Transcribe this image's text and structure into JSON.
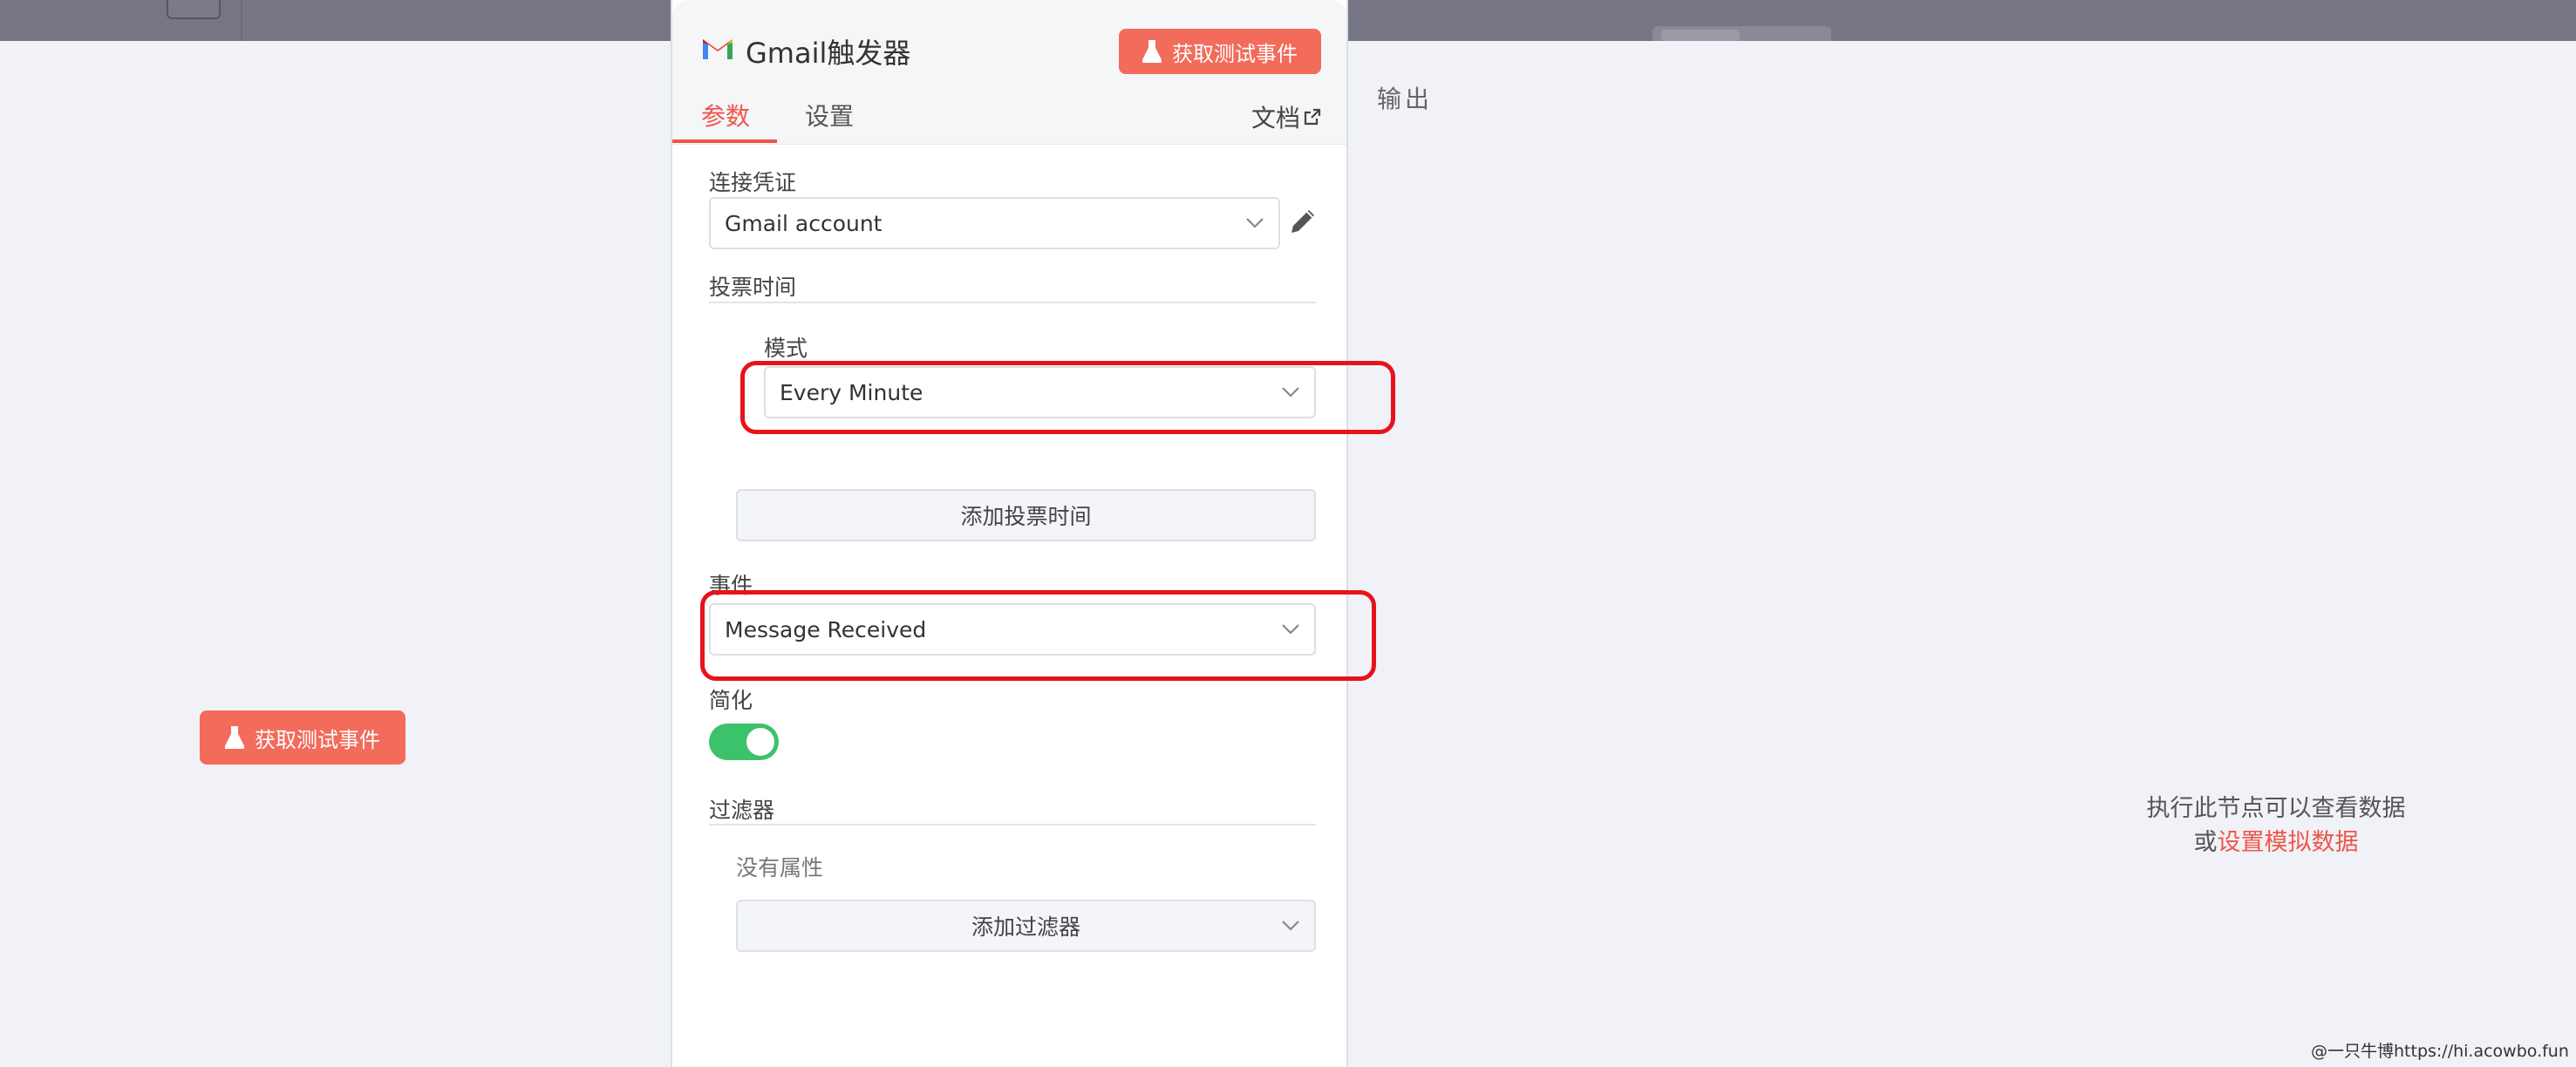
{
  "background": {
    "test_button_label": "获取测试事件"
  },
  "node": {
    "title": "Gmail触发器",
    "test_button_label": "获取测试事件",
    "tabs": [
      {
        "label": "参数"
      },
      {
        "label": "设置"
      }
    ],
    "active_tab": "参数",
    "docs_label": "文档"
  },
  "params": {
    "credential": {
      "label": "连接凭证",
      "value": "Gmail account"
    },
    "poll_times": {
      "section_label": "投票时间",
      "mode_label": "模式",
      "mode_value": "Every Minute",
      "add_button_label": "添加投票时间"
    },
    "event": {
      "label": "事件",
      "value": "Message Received"
    },
    "simplify": {
      "label": "简化",
      "enabled": true
    },
    "filters": {
      "section_label": "过滤器",
      "empty_text": "没有属性",
      "add_button_label": "添加过滤器"
    }
  },
  "output": {
    "label": "输出",
    "hint_line1": "执行此节点可以查看数据",
    "hint_prefix": "或",
    "hint_link": "设置模拟数据"
  },
  "watermark": "@一只牛博https://hi.acowbo.fun",
  "colors": {
    "accent": "#f26b5b",
    "link": "#f0554a",
    "toggle_on": "#3cc26b",
    "highlight": "#e8121a"
  }
}
